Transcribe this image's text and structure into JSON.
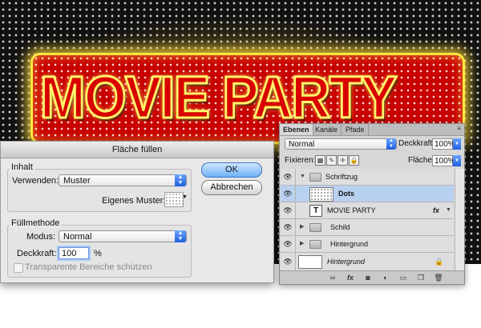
{
  "artwork": {
    "headline": "MOVIE PARTY"
  },
  "dialog": {
    "title": "Fläche füllen",
    "content_group": "Inhalt",
    "use_label": "Verwenden:",
    "use_value": "Muster",
    "custom_pattern_label": "Eigenes Muster:",
    "fill_group": "Füllmethode",
    "mode_label": "Modus:",
    "mode_value": "Normal",
    "opacity_label": "Deckkraft:",
    "opacity_value": "100",
    "opacity_unit": "%",
    "preserve_label": "Transparente Bereiche schützen",
    "ok_label": "OK",
    "cancel_label": "Abbrechen"
  },
  "layers": {
    "tabs": [
      "Ebenen",
      "Kanäle",
      "Pfade"
    ],
    "blend_mode": "Normal",
    "opacity_label": "Deckkraft:",
    "opacity_value": "100%",
    "lock_label": "Fixieren:",
    "fill_label": "Fläche:",
    "fill_value": "100%",
    "rows": [
      {
        "name": "Schriftzug"
      },
      {
        "name": "Dots"
      },
      {
        "name": "MOVIE PARTY",
        "fx": "fx"
      },
      {
        "name": "Schild"
      },
      {
        "name": "Hintergrund"
      },
      {
        "name": "Hintergrund"
      }
    ]
  }
}
